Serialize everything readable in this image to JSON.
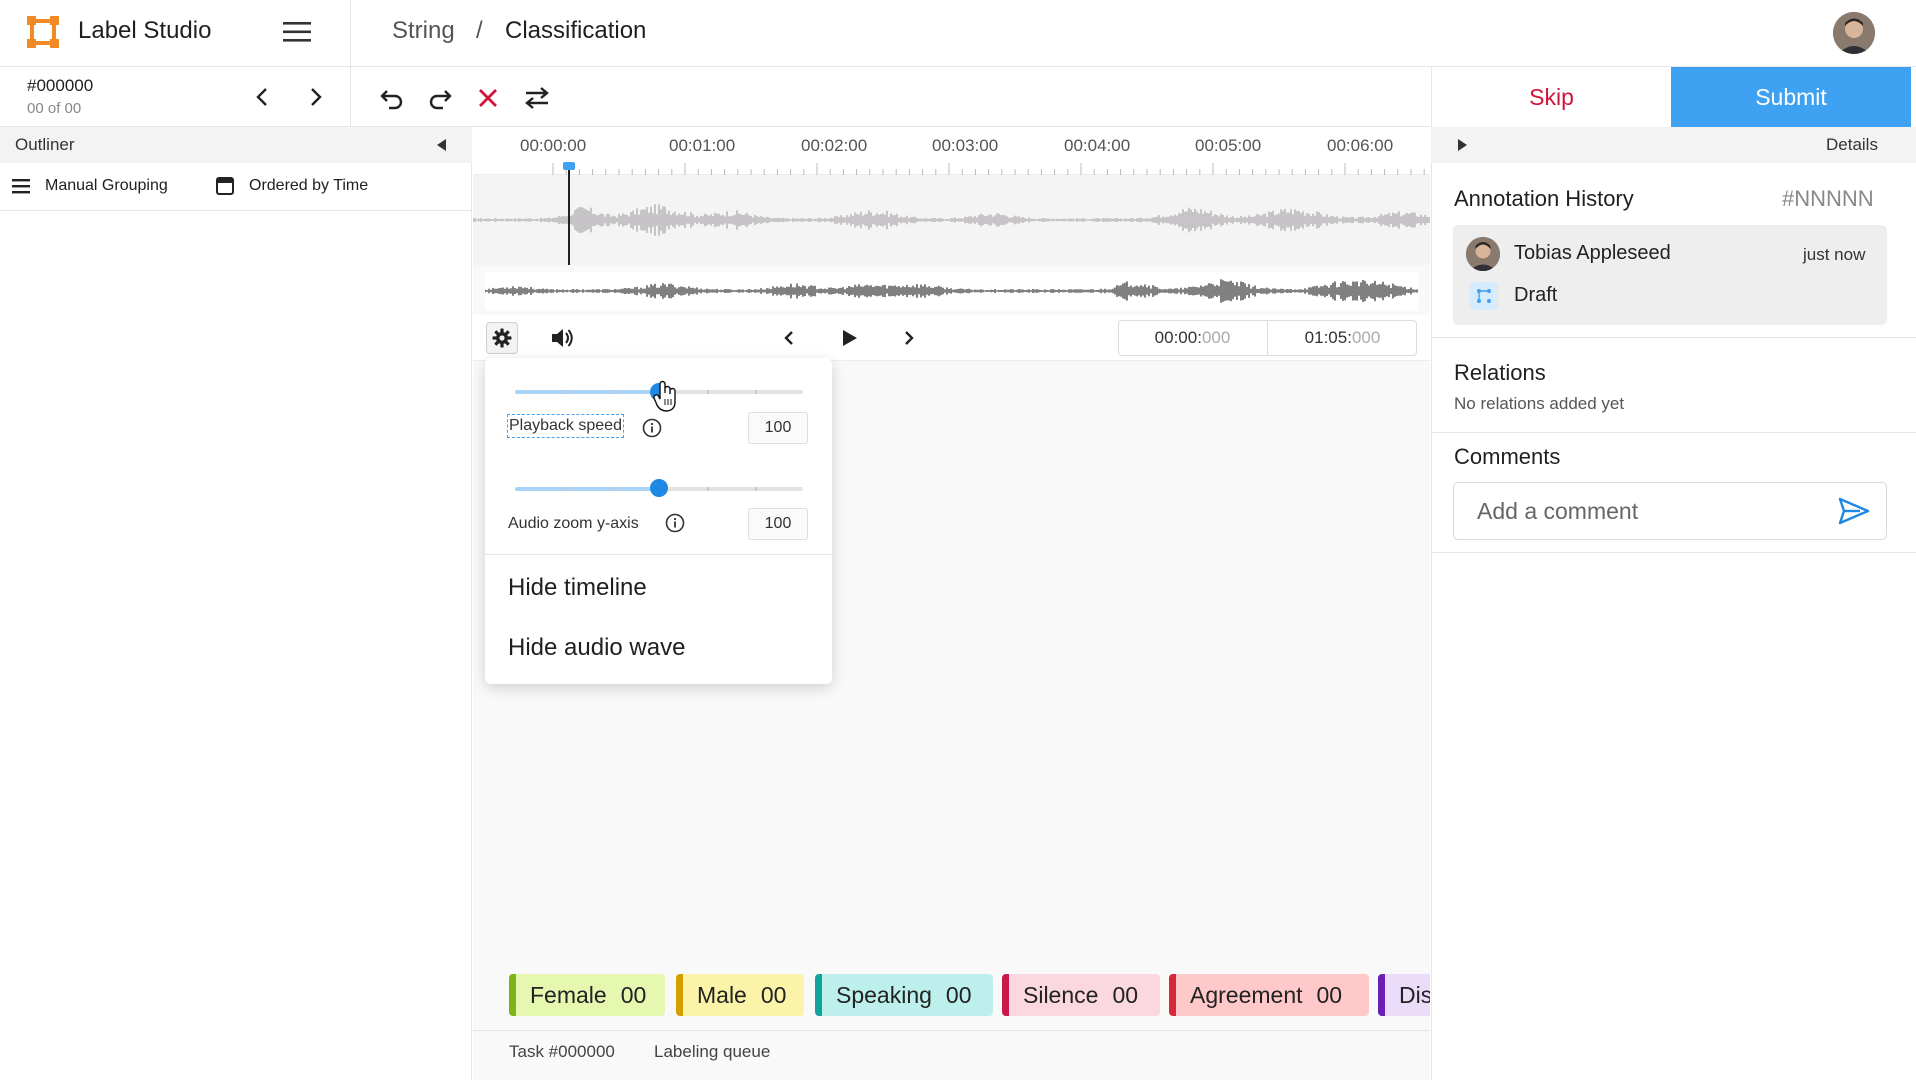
{
  "app": {
    "title": "Label Studio",
    "brand_color": "#f08a24"
  },
  "breadcrumb": {
    "project": "String",
    "separator": "/",
    "view": "Classification"
  },
  "task": {
    "id": "#000000",
    "count": "00 of 00"
  },
  "actions": {
    "skip": "Skip",
    "submit": "Submit",
    "skip_color": "#d1133d",
    "submit_color": "#3fa1f2"
  },
  "outliner": {
    "title": "Outliner",
    "grouping": "Manual Grouping",
    "ordering": "Ordered by Time"
  },
  "timeline": {
    "ticks": [
      "00:00:00",
      "00:01:00",
      "00:02:00",
      "00:03:00",
      "00:04:00",
      "00:05:00",
      "00:06:00"
    ],
    "current_main": "00:00:",
    "current_ms": "000",
    "total_main": "01:05:",
    "total_ms": "000"
  },
  "settings_popup": {
    "speed_label": "Playback speed",
    "speed_value": "100",
    "speed_slider_fraction": 0.5,
    "zoom_label": "Audio zoom y-axis",
    "zoom_value": "100",
    "zoom_slider_fraction": 0.5,
    "hide_timeline": "Hide timeline",
    "hide_wave": "Hide audio wave"
  },
  "labels": [
    {
      "name": "Female",
      "count": "00",
      "bg": "#e6f7b0",
      "border": "#7cb518"
    },
    {
      "name": "Male",
      "count": "00",
      "bg": "#fbf3a8",
      "border": "#d4a000"
    },
    {
      "name": "Speaking",
      "count": "00",
      "bg": "#bdf0ec",
      "border": "#13a39a"
    },
    {
      "name": "Silence",
      "count": "00",
      "bg": "#fbd7df",
      "border": "#c9184a"
    },
    {
      "name": "Agreement",
      "count": "00",
      "bg": "#ffc9c9",
      "border": "#d62839"
    },
    {
      "name": "Dis",
      "count": "",
      "bg": "#ebdcfa",
      "border": "#6a1fb5"
    }
  ],
  "footer": {
    "task": "Task #000000",
    "queue": "Labeling queue"
  },
  "details": {
    "label": "Details",
    "history_title": "Annotation History",
    "history_id": "#NNNNN",
    "user": "Tobias Appleseed",
    "time": "just now",
    "state": "Draft",
    "relations_title": "Relations",
    "relations_empty": "No relations added yet",
    "comments_title": "Comments",
    "comment_placeholder": "Add a comment"
  }
}
